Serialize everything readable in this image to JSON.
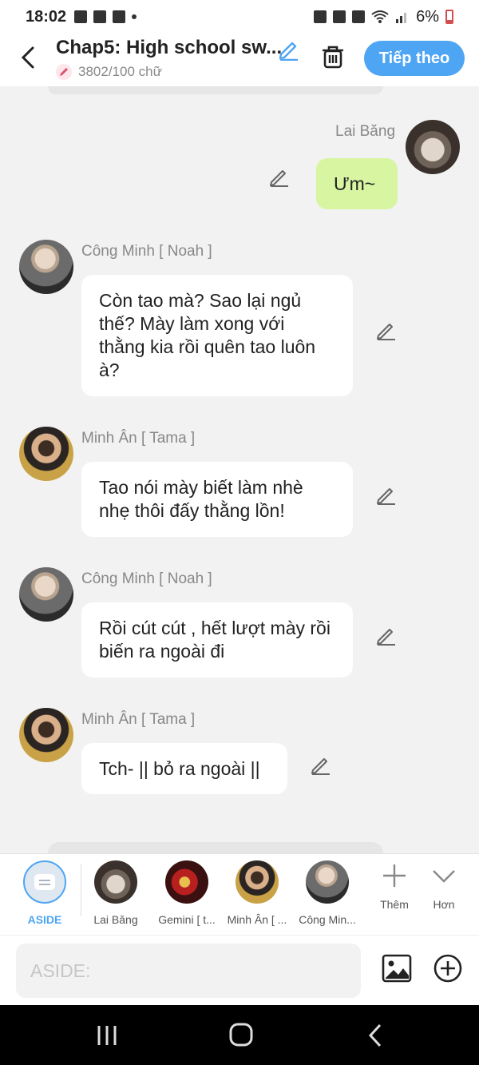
{
  "status_bar": {
    "time": "18:02",
    "battery": "6%"
  },
  "header": {
    "title": "Chap5: High school sw...",
    "word_count": "3802/100 chữ",
    "next_label": "Tiếp theo"
  },
  "messages": [
    {
      "sender": "Lai Băng",
      "text": "Ưm~"
    },
    {
      "sender": "Công Minh [ Noah ]",
      "text": "Còn tao mà? Sao lại ngủ thế? Mày làm xong với thằng kia rồi quên tao luôn à?"
    },
    {
      "sender": "Minh Ân [ Tama ]",
      "text": "Tao nói mày biết làm nhè nhẹ thôi đấy thằng lồn!"
    },
    {
      "sender": "Công Minh [ Noah ]",
      "text": "Rồi cút cút , hết lượt mày rồi biến ra ngoài đi"
    },
    {
      "sender": "Minh Ân [ Tama ]",
      "text": "Tch- || bỏ ra ngoài ||"
    }
  ],
  "characters": [
    {
      "label": "ASIDE"
    },
    {
      "label": "Lai Băng"
    },
    {
      "label": "Gemini [ t..."
    },
    {
      "label": "Minh Ân [ ..."
    },
    {
      "label": "Công Min..."
    }
  ],
  "tools": {
    "more_label": "Thêm",
    "less_label": "Hơn"
  },
  "input": {
    "placeholder": "ASIDE:"
  },
  "icons": [
    "back-icon",
    "edit-icon",
    "pencil-icon",
    "trash-icon",
    "plus-icon",
    "chevron-down-icon",
    "image-icon",
    "add-circle-icon",
    "recents-icon",
    "home-icon",
    "nav-back-icon"
  ],
  "colors": {
    "accent": "#4ea5f3",
    "bubble_green": "#d8f5a2",
    "bubble_white": "#ffffff"
  }
}
